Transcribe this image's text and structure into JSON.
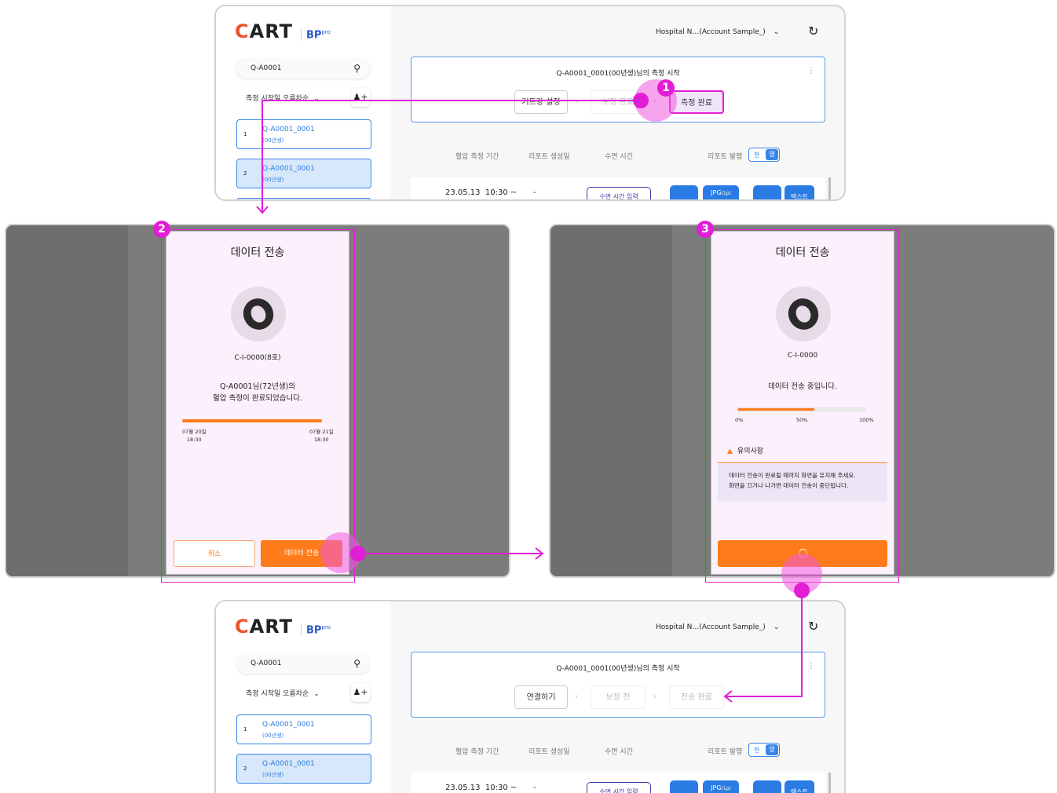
{
  "app": {
    "logo": {
      "cart": "CART",
      "bp": "BP",
      "pro": "pro"
    },
    "search": {
      "value": "Q-A0001"
    },
    "sort_label": "측정 시작일 오름차순",
    "patients": [
      {
        "num": "1",
        "id": "Q-A0001_0001",
        "year": "(00년생)"
      },
      {
        "num": "2",
        "id": "Q-A0001_0001",
        "year": "(00년생)"
      }
    ],
    "hospital": "Hospital N…(Account Sample_)",
    "session_title": "Q-A0001_0001(00년생)님의 측정 시작",
    "steps_top": [
      "거트랑 설정",
      "보정 완료",
      "측정 완료"
    ],
    "steps_bottom": [
      "연결하기",
      "보정 전",
      "전송 완료"
    ],
    "headers": [
      "혈압 측정 기간",
      "리포트 생성일",
      "수면 시간",
      "리포트 발행"
    ],
    "toggle": {
      "ko": "한",
      "en": "영"
    },
    "row": {
      "date": "23.05.13",
      "time": "10:30 ~",
      "dash": "-",
      "sleep_btn": "수면 시간 입력",
      "jpg": "JPG",
      "jpg_sub": "(1p)",
      "text_btn": "텍스트"
    }
  },
  "modal2": {
    "title": "데이터 전송",
    "device": "C-I-0000(8호)",
    "message_1": "Q-A0001님(72년생)의",
    "message_2": "혈압 측정이 완료되었습니다.",
    "start_date": "07월 20일",
    "start_time": "18:30",
    "end_date": "07월 21일",
    "end_time": "18:30",
    "cancel": "취소",
    "send": "데이터 전송"
  },
  "modal3": {
    "title": "데이터 전송",
    "device": "C-I-0000",
    "message": "데이터 전송 중입니다.",
    "progress": 0.6,
    "pct": [
      "0%",
      "50%",
      "100%"
    ],
    "warn_title": "유의사항",
    "warn_1": "데이터 전송이 완료될 때까지 화면을 유지해 주세요.",
    "warn_2": "화면을 끄거나 나가면 데이터 전송이 중단됩니다."
  },
  "badges": [
    "1",
    "2",
    "3"
  ],
  "colors": {
    "accent": "#ff7a1a",
    "annotation": "#e11ed6",
    "primary": "#2a7be4"
  }
}
